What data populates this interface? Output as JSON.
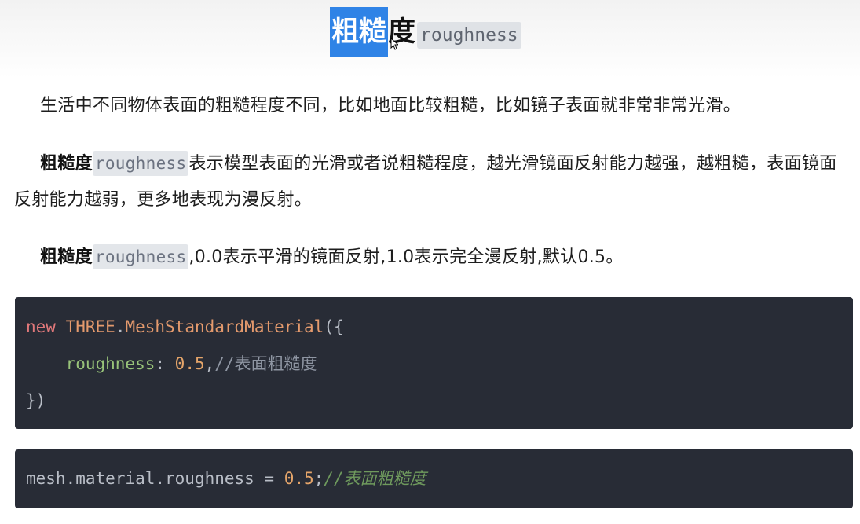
{
  "heading": {
    "selected": "粗糙",
    "rest": "度",
    "code": "roughness"
  },
  "para1": {
    "text": "生活中不同物体表面的粗糙程度不同，比如地面比较粗糙，比如镜子表面就非常非常光滑。"
  },
  "para2": {
    "bold": "粗糙度",
    "code": "roughness",
    "text": "表示模型表面的光滑或者说粗糙程度，越光滑镜面反射能力越强，越粗糙，表面镜面反射能力越弱，更多地表现为漫反射。"
  },
  "para3": {
    "bold": "粗糙度",
    "code": "roughness",
    "text": ",0.0表示平滑的镜面反射,1.0表示完全漫反射,默认0.5。"
  },
  "code_block_1": {
    "line1": {
      "kw": "new",
      "cls": "THREE",
      "dot": ".",
      "fn": "MeshStandardMaterial",
      "punct": "({"
    },
    "line2": {
      "indent": "    ",
      "prop": "roughness",
      "colon": ": ",
      "value": "0.5",
      "comma": ",",
      "comment": "//表面粗糙度"
    },
    "line3": {
      "punct": "})"
    }
  },
  "code_block_2": {
    "code": "mesh.material.roughness = ",
    "value": "0.5",
    "semi": ";",
    "comment": "//表面粗糙度"
  },
  "colors": {
    "selection": "#2f83e6",
    "code_bg": "#282c36",
    "inline_code_bg": "#e3e6ea"
  }
}
